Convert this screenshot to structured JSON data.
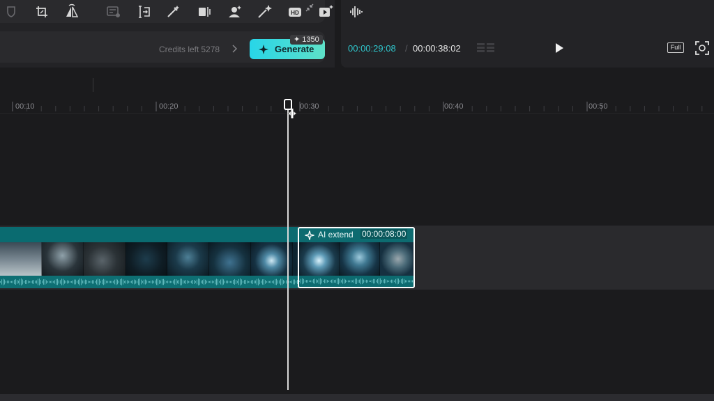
{
  "generate_panel": {
    "credits_label": "Credits left",
    "credits_value": "5278",
    "generate_label": "Generate",
    "cost_badge": "✦ 1350"
  },
  "player": {
    "current_time": "00:00:29:08",
    "separator": "/",
    "total_time": "00:00:38:02",
    "full_label": "Full"
  },
  "toolbar": {
    "tools": [
      "shield-icon",
      "crop-icon",
      "mirror-icon",
      "text-replace-icon",
      "split-icon",
      "magic-wand-icon",
      "freeze-frame-icon",
      "remove-background-icon",
      "enhance-icon",
      "hd-icon",
      "video-effect-icon",
      "audio-split-icon"
    ]
  },
  "ruler": {
    "labels": [
      "00:10",
      "00:20",
      "00:30",
      "00:40",
      "00:50"
    ]
  },
  "timeline": {
    "extend_clip": {
      "label": "AI extend",
      "duration": "00:00:08:00"
    }
  },
  "colors": {
    "accent_cyan": "#2fc6cc",
    "track_teal": "#0e6f73"
  }
}
